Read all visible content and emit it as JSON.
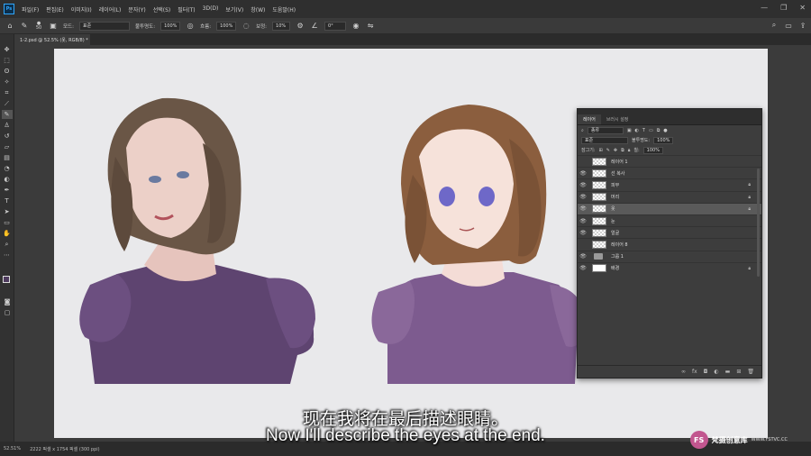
{
  "app": {
    "logo": "Ps"
  },
  "menu": [
    "파일(F)",
    "편집(E)",
    "이미지(I)",
    "레이어(L)",
    "문자(Y)",
    "선택(S)",
    "필터(T)",
    "3D(D)",
    "보기(V)",
    "창(W)",
    "도움말(H)"
  ],
  "window_controls": [
    "—",
    "❐",
    "✕"
  ],
  "options": {
    "brush_size": "50",
    "mode_label": "모드:",
    "mode_value": "표준",
    "opacity_label": "불투명도:",
    "opacity_value": "100%",
    "flow_label": "흐름:",
    "flow_value": "100%",
    "smoothing_label": "보정:",
    "smoothing_value": "10%",
    "angle_value": "0°"
  },
  "document_tab": "1-2.psd @ 52.5% (옷, RGB/8) *",
  "layers_panel": {
    "tabs": [
      "레이어",
      "브러시 설정"
    ],
    "filter_kind": "종류",
    "blend_mode": "표준",
    "opacity_label": "불투명도:",
    "opacity_value": "100%",
    "lock_label": "잠그기:",
    "fill_label": "칠:",
    "fill_value": "100%",
    "layers": [
      {
        "name": "레이어 1",
        "visible": false,
        "thumb": "checker",
        "locked": false,
        "selected": false
      },
      {
        "name": "선 복사",
        "visible": true,
        "thumb": "checker",
        "locked": false,
        "selected": false
      },
      {
        "name": "피부",
        "visible": true,
        "thumb": "checker",
        "locked": true,
        "selected": false
      },
      {
        "name": "머리",
        "visible": true,
        "thumb": "checker",
        "locked": true,
        "selected": false
      },
      {
        "name": "옷",
        "visible": true,
        "thumb": "checker",
        "locked": true,
        "selected": true
      },
      {
        "name": "눈",
        "visible": true,
        "thumb": "checker",
        "locked": false,
        "selected": false
      },
      {
        "name": "얼굴",
        "visible": true,
        "thumb": "checker",
        "locked": false,
        "selected": false
      },
      {
        "name": "레이어 8",
        "visible": false,
        "thumb": "checker",
        "locked": false,
        "selected": false
      },
      {
        "name": "그룹 1",
        "visible": true,
        "thumb": "folder",
        "locked": false,
        "selected": false
      },
      {
        "name": "배경",
        "visible": true,
        "thumb": "white",
        "locked": true,
        "selected": false
      }
    ]
  },
  "status": {
    "zoom": "52.51%",
    "doc_size": "2222 픽셀 x 1754 픽셀 (300 ppi)"
  },
  "subtitles": {
    "cn": "现在我将在最后描述眼睛。",
    "en": "Now I'll describe the eyes at the end."
  },
  "watermark": {
    "logo": "FS",
    "text": "梵摄创意库",
    "url": "WWW.FSTVC.CC"
  },
  "colors": {
    "foreground": "#4e3b5e",
    "background": "#ffffff",
    "accent": "#31a8ff"
  }
}
